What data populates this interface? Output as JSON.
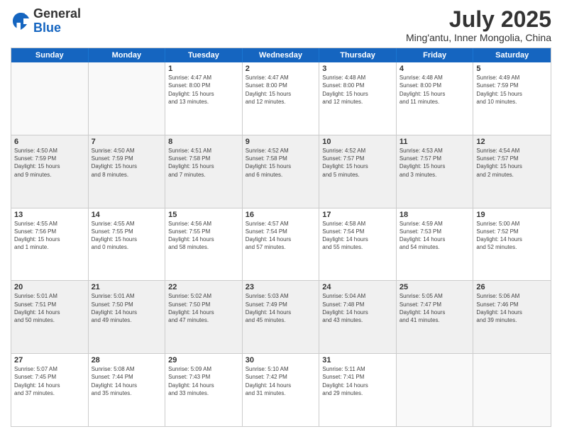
{
  "logo": {
    "general": "General",
    "blue": "Blue"
  },
  "title": "July 2025",
  "subtitle": "Ming'antu, Inner Mongolia, China",
  "header": {
    "days": [
      "Sunday",
      "Monday",
      "Tuesday",
      "Wednesday",
      "Thursday",
      "Friday",
      "Saturday"
    ]
  },
  "weeks": [
    [
      {
        "day": "",
        "info": ""
      },
      {
        "day": "",
        "info": ""
      },
      {
        "day": "1",
        "info": "Sunrise: 4:47 AM\nSunset: 8:00 PM\nDaylight: 15 hours\nand 13 minutes."
      },
      {
        "day": "2",
        "info": "Sunrise: 4:47 AM\nSunset: 8:00 PM\nDaylight: 15 hours\nand 12 minutes."
      },
      {
        "day": "3",
        "info": "Sunrise: 4:48 AM\nSunset: 8:00 PM\nDaylight: 15 hours\nand 12 minutes."
      },
      {
        "day": "4",
        "info": "Sunrise: 4:48 AM\nSunset: 8:00 PM\nDaylight: 15 hours\nand 11 minutes."
      },
      {
        "day": "5",
        "info": "Sunrise: 4:49 AM\nSunset: 7:59 PM\nDaylight: 15 hours\nand 10 minutes."
      }
    ],
    [
      {
        "day": "6",
        "info": "Sunrise: 4:50 AM\nSunset: 7:59 PM\nDaylight: 15 hours\nand 9 minutes."
      },
      {
        "day": "7",
        "info": "Sunrise: 4:50 AM\nSunset: 7:59 PM\nDaylight: 15 hours\nand 8 minutes."
      },
      {
        "day": "8",
        "info": "Sunrise: 4:51 AM\nSunset: 7:58 PM\nDaylight: 15 hours\nand 7 minutes."
      },
      {
        "day": "9",
        "info": "Sunrise: 4:52 AM\nSunset: 7:58 PM\nDaylight: 15 hours\nand 6 minutes."
      },
      {
        "day": "10",
        "info": "Sunrise: 4:52 AM\nSunset: 7:57 PM\nDaylight: 15 hours\nand 5 minutes."
      },
      {
        "day": "11",
        "info": "Sunrise: 4:53 AM\nSunset: 7:57 PM\nDaylight: 15 hours\nand 3 minutes."
      },
      {
        "day": "12",
        "info": "Sunrise: 4:54 AM\nSunset: 7:57 PM\nDaylight: 15 hours\nand 2 minutes."
      }
    ],
    [
      {
        "day": "13",
        "info": "Sunrise: 4:55 AM\nSunset: 7:56 PM\nDaylight: 15 hours\nand 1 minute."
      },
      {
        "day": "14",
        "info": "Sunrise: 4:55 AM\nSunset: 7:55 PM\nDaylight: 15 hours\nand 0 minutes."
      },
      {
        "day": "15",
        "info": "Sunrise: 4:56 AM\nSunset: 7:55 PM\nDaylight: 14 hours\nand 58 minutes."
      },
      {
        "day": "16",
        "info": "Sunrise: 4:57 AM\nSunset: 7:54 PM\nDaylight: 14 hours\nand 57 minutes."
      },
      {
        "day": "17",
        "info": "Sunrise: 4:58 AM\nSunset: 7:54 PM\nDaylight: 14 hours\nand 55 minutes."
      },
      {
        "day": "18",
        "info": "Sunrise: 4:59 AM\nSunset: 7:53 PM\nDaylight: 14 hours\nand 54 minutes."
      },
      {
        "day": "19",
        "info": "Sunrise: 5:00 AM\nSunset: 7:52 PM\nDaylight: 14 hours\nand 52 minutes."
      }
    ],
    [
      {
        "day": "20",
        "info": "Sunrise: 5:01 AM\nSunset: 7:51 PM\nDaylight: 14 hours\nand 50 minutes."
      },
      {
        "day": "21",
        "info": "Sunrise: 5:01 AM\nSunset: 7:50 PM\nDaylight: 14 hours\nand 49 minutes."
      },
      {
        "day": "22",
        "info": "Sunrise: 5:02 AM\nSunset: 7:50 PM\nDaylight: 14 hours\nand 47 minutes."
      },
      {
        "day": "23",
        "info": "Sunrise: 5:03 AM\nSunset: 7:49 PM\nDaylight: 14 hours\nand 45 minutes."
      },
      {
        "day": "24",
        "info": "Sunrise: 5:04 AM\nSunset: 7:48 PM\nDaylight: 14 hours\nand 43 minutes."
      },
      {
        "day": "25",
        "info": "Sunrise: 5:05 AM\nSunset: 7:47 PM\nDaylight: 14 hours\nand 41 minutes."
      },
      {
        "day": "26",
        "info": "Sunrise: 5:06 AM\nSunset: 7:46 PM\nDaylight: 14 hours\nand 39 minutes."
      }
    ],
    [
      {
        "day": "27",
        "info": "Sunrise: 5:07 AM\nSunset: 7:45 PM\nDaylight: 14 hours\nand 37 minutes."
      },
      {
        "day": "28",
        "info": "Sunrise: 5:08 AM\nSunset: 7:44 PM\nDaylight: 14 hours\nand 35 minutes."
      },
      {
        "day": "29",
        "info": "Sunrise: 5:09 AM\nSunset: 7:43 PM\nDaylight: 14 hours\nand 33 minutes."
      },
      {
        "day": "30",
        "info": "Sunrise: 5:10 AM\nSunset: 7:42 PM\nDaylight: 14 hours\nand 31 minutes."
      },
      {
        "day": "31",
        "info": "Sunrise: 5:11 AM\nSunset: 7:41 PM\nDaylight: 14 hours\nand 29 minutes."
      },
      {
        "day": "",
        "info": ""
      },
      {
        "day": "",
        "info": ""
      }
    ]
  ]
}
